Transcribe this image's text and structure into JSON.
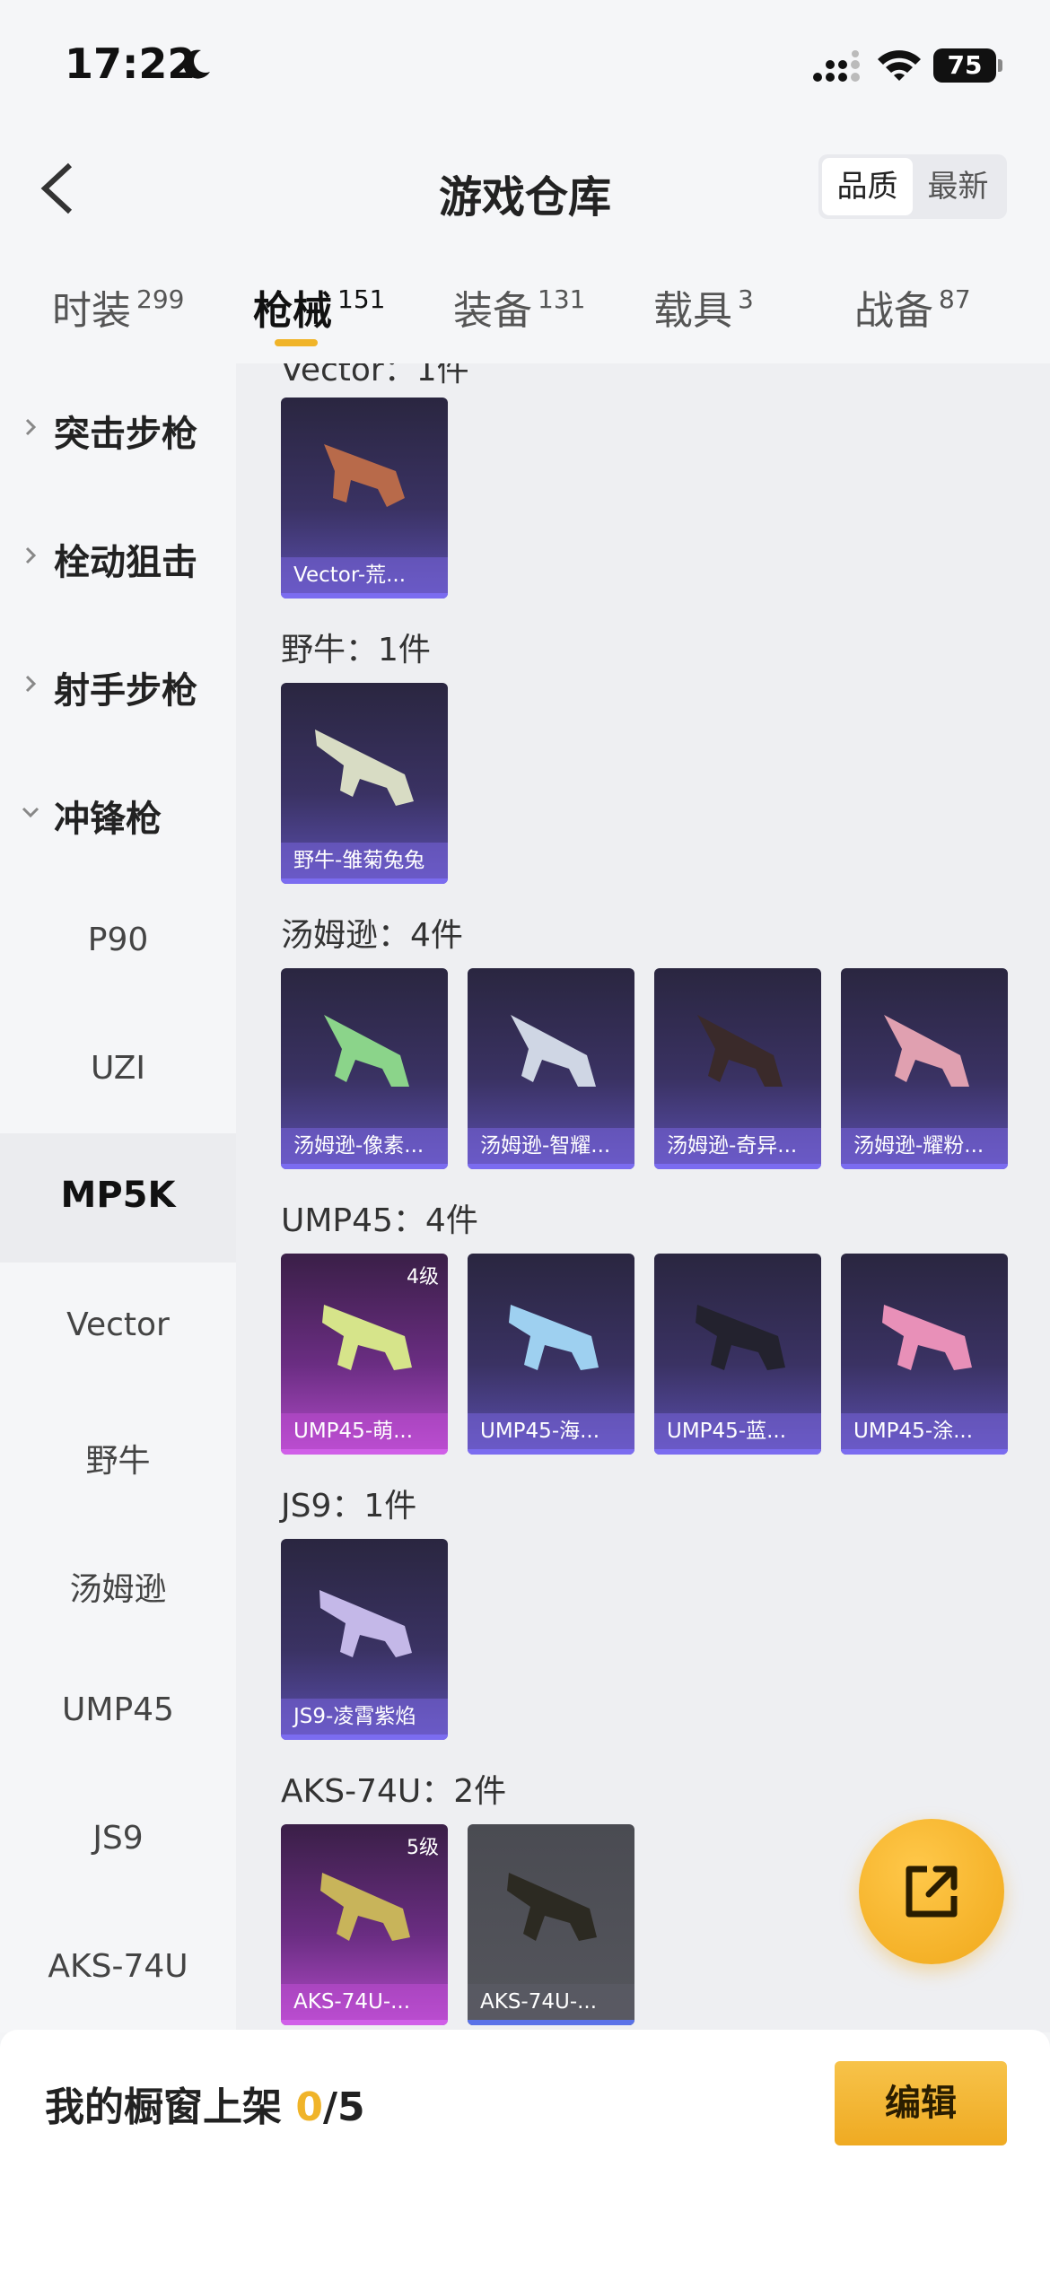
{
  "status_bar": {
    "time": "17:22",
    "battery": "75"
  },
  "header": {
    "title": "游戏仓库",
    "sort_options": [
      "品质",
      "最新"
    ],
    "sort_selected": "品质"
  },
  "tabs": [
    {
      "label": "时装",
      "count": "299"
    },
    {
      "label": "枪械",
      "count": "151",
      "active": true
    },
    {
      "label": "装备",
      "count": "131"
    },
    {
      "label": "载具",
      "count": "3"
    },
    {
      "label": "战备",
      "count": "87"
    }
  ],
  "sidebar": {
    "categories": [
      "突击步枪",
      "栓动狙击",
      "射手步枪",
      "冲锋枪"
    ],
    "subitems": [
      "P90",
      "UZI",
      "MP5K",
      "Vector",
      "野牛",
      "汤姆逊",
      "UMP45",
      "JS9",
      "AKS-74U"
    ],
    "selected": "MP5K"
  },
  "sections": [
    {
      "title": "Vector：1件",
      "items": [
        {
          "name": "Vector-荒...",
          "rarity": "purple"
        }
      ]
    },
    {
      "title": "野牛：1件",
      "items": [
        {
          "name": "野牛-雏菊兔兔",
          "rarity": "purple"
        }
      ]
    },
    {
      "title": "汤姆逊：4件",
      "items": [
        {
          "name": "汤姆逊-像素...",
          "rarity": "purple"
        },
        {
          "name": "汤姆逊-智耀...",
          "rarity": "purple"
        },
        {
          "name": "汤姆逊-奇异...",
          "rarity": "purple"
        },
        {
          "name": "汤姆逊-耀粉...",
          "rarity": "purple"
        }
      ]
    },
    {
      "title": "UMP45：4件",
      "items": [
        {
          "name": "UMP45-萌...",
          "rarity": "pink",
          "level": "4级"
        },
        {
          "name": "UMP45-海...",
          "rarity": "purple"
        },
        {
          "name": "UMP45-蓝...",
          "rarity": "purple"
        },
        {
          "name": "UMP45-涂...",
          "rarity": "purple"
        }
      ]
    },
    {
      "title": "JS9：1件",
      "items": [
        {
          "name": "JS9-凌霄紫焰",
          "rarity": "purple"
        }
      ]
    },
    {
      "title": "AKS-74U：2件",
      "items": [
        {
          "name": "AKS-74U-...",
          "rarity": "pink",
          "level": "5级"
        },
        {
          "name": "AKS-74U-...",
          "rarity": "gray"
        }
      ]
    }
  ],
  "bottom": {
    "shelf_label": "我的橱窗上架 ",
    "shelf_current": "0",
    "shelf_total": "/5",
    "edit_label": "编辑"
  },
  "colors": {
    "accent": "#f0b429",
    "purple_card": "#5b4fb0",
    "pink_card": "#b24bc9"
  },
  "icons": {
    "fab": "share-external-icon",
    "back": "chevron-left-icon"
  }
}
